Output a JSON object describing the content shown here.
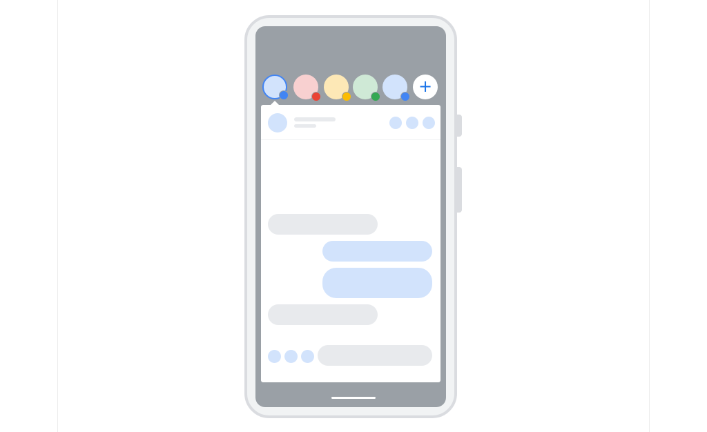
{
  "bubbles": [
    {
      "name": "bubble-1",
      "fill": "#d2e3fc",
      "badge": "#4285f4",
      "selected": true
    },
    {
      "name": "bubble-2",
      "fill": "#f8d0d0",
      "badge": "#ea4335",
      "selected": false
    },
    {
      "name": "bubble-3",
      "fill": "#fde8b6",
      "badge": "#fbbc04",
      "selected": false
    },
    {
      "name": "bubble-4",
      "fill": "#cfe9d6",
      "badge": "#34a853",
      "selected": false
    },
    {
      "name": "bubble-5",
      "fill": "#d2e3fc",
      "badge": "#4285f4",
      "selected": false
    }
  ],
  "add_button": {
    "icon": "plus-icon",
    "glyph": "+"
  },
  "conversation": {
    "messages": [
      {
        "direction": "incoming"
      },
      {
        "direction": "outgoing"
      },
      {
        "direction": "outgoing"
      },
      {
        "direction": "incoming"
      }
    ]
  },
  "colors": {
    "screen": "#9aa0a6",
    "accent": "#1a73e8",
    "outgoing_bubble": "#d2e3fc",
    "incoming_bubble": "#e8eaed"
  }
}
